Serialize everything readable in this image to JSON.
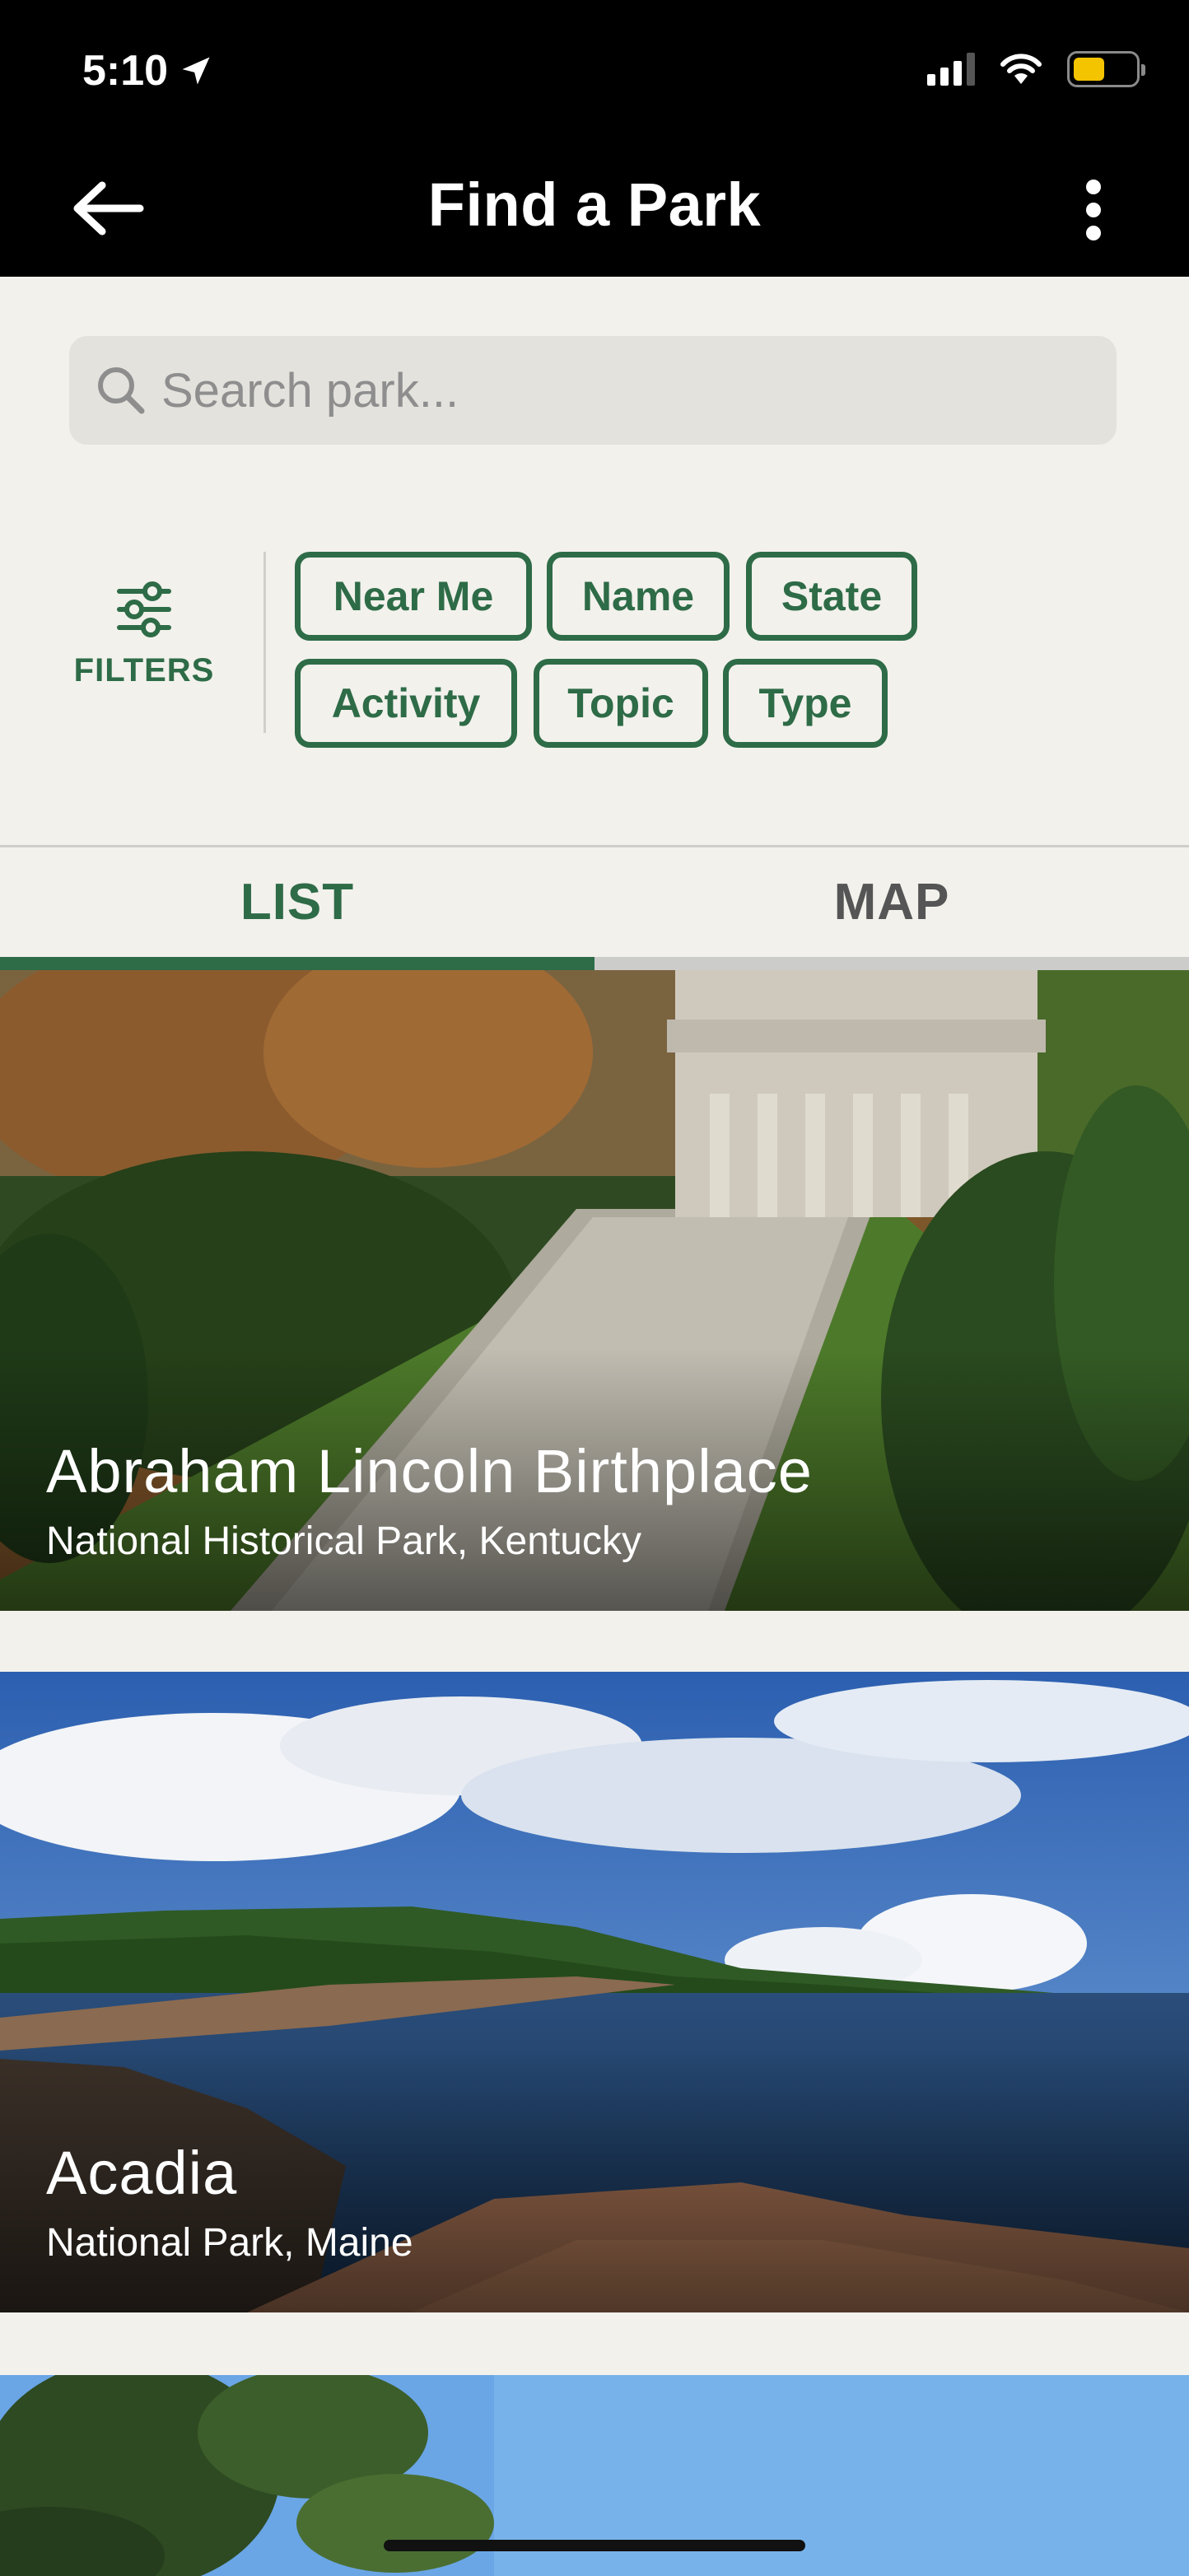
{
  "status_bar": {
    "time": "5:10"
  },
  "header": {
    "title": "Find a Park"
  },
  "search": {
    "placeholder": "Search park..."
  },
  "filters": {
    "label": "FILTERS",
    "chips": [
      "Near Me",
      "Name",
      "State",
      "Activity",
      "Topic",
      "Type"
    ]
  },
  "tabs": {
    "list": "LIST",
    "map": "MAP"
  },
  "parks": [
    {
      "name": "Abraham Lincoln Birthplace",
      "subtitle": "National Historical Park, Kentucky"
    },
    {
      "name": "Acadia",
      "subtitle": "National Park, Maine"
    }
  ],
  "colors": {
    "accent": "#2e6b47",
    "background": "#f2f1ec",
    "header": "#000000"
  }
}
